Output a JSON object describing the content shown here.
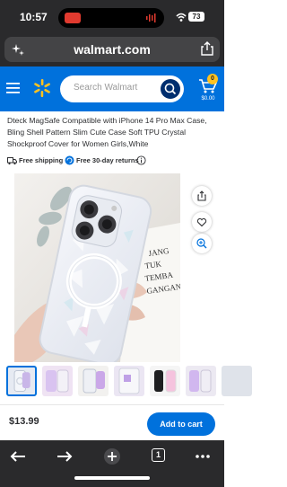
{
  "status": {
    "time": "10:57",
    "battery": "73"
  },
  "browser": {
    "url": "walmart.com"
  },
  "header": {
    "search_placeholder": "Search Walmart",
    "cart_count": "0",
    "cart_total": "$0.00"
  },
  "product": {
    "title": "Dteck MagSafe Compatible with iPhone 14 Pro Max Case, Bling Shell Pattern Slim Cute Case Soft TPU Crystal Shockproof Cover for Women Girls,White",
    "free_shipping": "Free shipping",
    "free_returns": "Free 30-day returns",
    "price": "$13.99",
    "add_to_cart": "Add to cart",
    "book_text": [
      "JANG",
      "TUK",
      "TEMBA",
      "GANGAN"
    ]
  },
  "gallery": {
    "thumbnail_count": 7,
    "selected_index": 0
  },
  "navbar": {
    "tab_count": "1"
  },
  "colors": {
    "walmart_blue": "#0071dc",
    "walmart_yellow": "#ffc220",
    "dark_navy": "#002e6e",
    "browser_chrome": "#2a2a2c"
  }
}
